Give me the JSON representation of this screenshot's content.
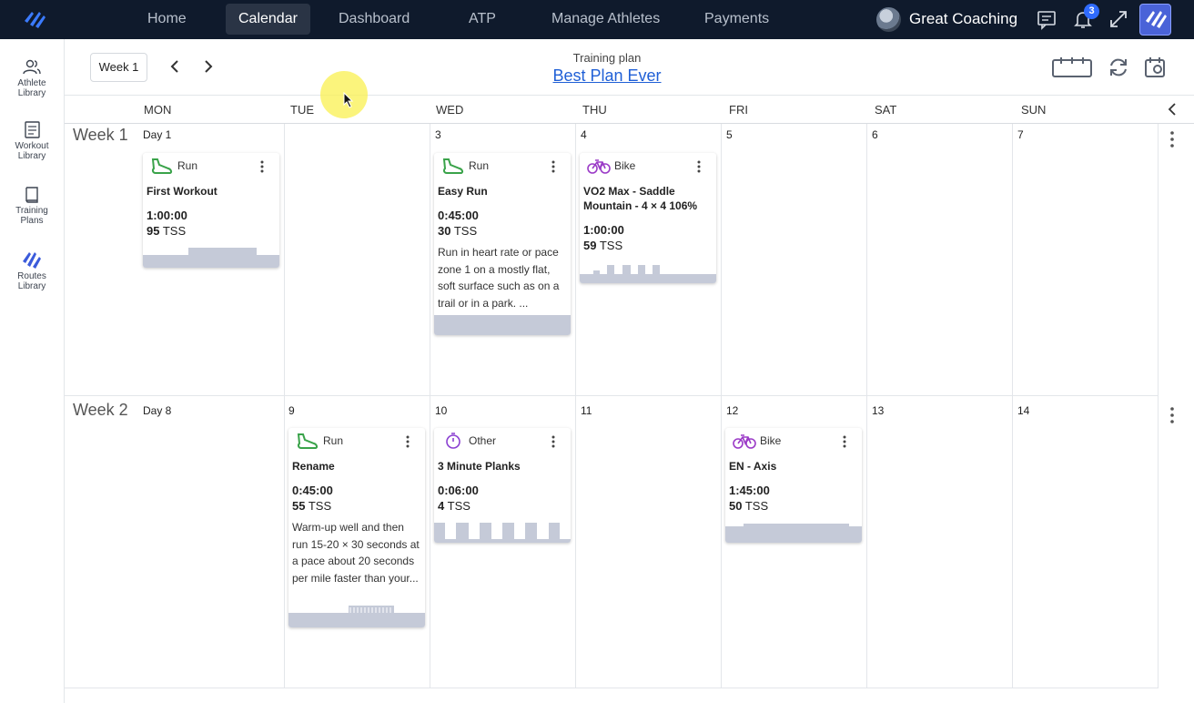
{
  "nav": {
    "items": [
      {
        "label": "Home"
      },
      {
        "label": "Calendar"
      },
      {
        "label": "Dashboard"
      },
      {
        "label": "ATP"
      },
      {
        "label": "Manage Athletes"
      },
      {
        "label": "Payments"
      }
    ],
    "active": "Calendar",
    "user_name": "Great Coaching",
    "notification_count": "3"
  },
  "sidebar": {
    "items": [
      {
        "label": "Athlete\nLibrary",
        "icon": "people-icon"
      },
      {
        "label": "Workout\nLibrary",
        "icon": "list-icon"
      },
      {
        "label": "Training\nPlans",
        "icon": "book-icon"
      },
      {
        "label": "Routes\nLibrary",
        "icon": "routes-logo-icon"
      }
    ]
  },
  "header": {
    "week_select": "Week 1",
    "plan_caption": "Training plan",
    "plan_title": "Best Plan Ever"
  },
  "days": [
    "MON",
    "TUE",
    "WED",
    "THU",
    "FRI",
    "SAT",
    "SUN"
  ],
  "weeks": [
    {
      "label": "Week 1",
      "dates": [
        "Day 1",
        "",
        "3",
        "4",
        "5",
        "6",
        "7"
      ],
      "workouts": [
        {
          "sport": "Run",
          "title": "First Workout",
          "duration": "1:00:00",
          "tss_value": "95",
          "tss_unit": "TSS",
          "description": ""
        },
        {
          "sport": "Run",
          "title": "Easy Run",
          "duration": "0:45:00",
          "tss_value": "30",
          "tss_unit": "TSS",
          "description": "Run in heart rate or pace zone 1 on a mostly flat, soft surface such as on a trail or in a park. ..."
        },
        {
          "sport": "Bike",
          "title": "VO2 Max - Saddle Mountain - 4 × 4 106%",
          "duration": "1:00:00",
          "tss_value": "59",
          "tss_unit": "TSS",
          "description": ""
        }
      ]
    },
    {
      "label": "Week 2",
      "dates": [
        "Day 8",
        "9",
        "10",
        "11",
        "12",
        "13",
        "14"
      ],
      "workouts": [
        {
          "sport": "Run",
          "title": "Rename",
          "duration": "0:45:00",
          "tss_value": "55",
          "tss_unit": "TSS",
          "description": "Warm-up well and then run 15-20 × 30 seconds at a pace about 20 seconds per mile faster than your..."
        },
        {
          "sport": "Other",
          "title": "3 Minute Planks",
          "duration": "0:06:00",
          "tss_value": "4",
          "tss_unit": "TSS",
          "description": ""
        },
        {
          "sport": "Bike",
          "title": "EN - Axis",
          "duration": "1:45:00",
          "tss_value": "50",
          "tss_unit": "TSS",
          "description": ""
        }
      ]
    }
  ],
  "colors": {
    "nav_bg": "#0f1a2c",
    "link": "#1f5fd6",
    "run_icon": "#3aa34a",
    "bike_icon": "#9b3bc7",
    "other_icon": "#8a3fd1",
    "chart_fill": "#c5cad8",
    "badge": "#2f6bff"
  }
}
